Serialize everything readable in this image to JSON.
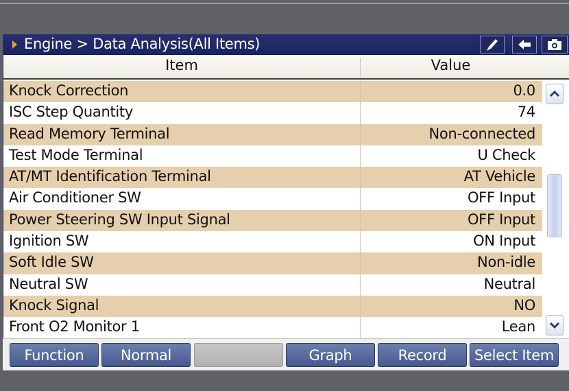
{
  "titlebar": {
    "breadcrumb": "Engine > Data Analysis(All Items)",
    "buttons": [
      {
        "name": "pen-icon"
      },
      {
        "name": "back-arrow-icon"
      },
      {
        "name": "camera-icon"
      }
    ]
  },
  "table": {
    "headers": {
      "item": "Item",
      "value": "Value"
    },
    "rows": [
      {
        "item": "Knock Correction",
        "value": "0.0"
      },
      {
        "item": "ISC Step Quantity",
        "value": "74"
      },
      {
        "item": "Read Memory Terminal",
        "value": "Non-connected"
      },
      {
        "item": "Test Mode Terminal",
        "value": "U Check"
      },
      {
        "item": "AT/MT Identification Terminal",
        "value": "AT Vehicle"
      },
      {
        "item": "Air Conditioner SW",
        "value": "OFF Input"
      },
      {
        "item": "Power Steering SW Input Signal",
        "value": "OFF Input"
      },
      {
        "item": "Ignition SW",
        "value": "ON Input"
      },
      {
        "item": "Soft Idle SW",
        "value": "Non-idle"
      },
      {
        "item": "Neutral SW",
        "value": "Neutral"
      },
      {
        "item": "Knock Signal",
        "value": "NO"
      },
      {
        "item": "Front O2 Monitor 1",
        "value": "Lean"
      }
    ]
  },
  "scrollbar": {
    "up_icon": "chevron-up-icon",
    "down_icon": "chevron-down-icon"
  },
  "function_bar": {
    "function": "Function",
    "normal": "Normal",
    "blank": "",
    "graph": "Graph",
    "record": "Record",
    "select_item": "Select Item"
  },
  "colors": {
    "title_bar": "#1f2866",
    "row_stripe": "#e6cfac",
    "button": "#5668a0",
    "title_arrow": "#f0a020"
  }
}
